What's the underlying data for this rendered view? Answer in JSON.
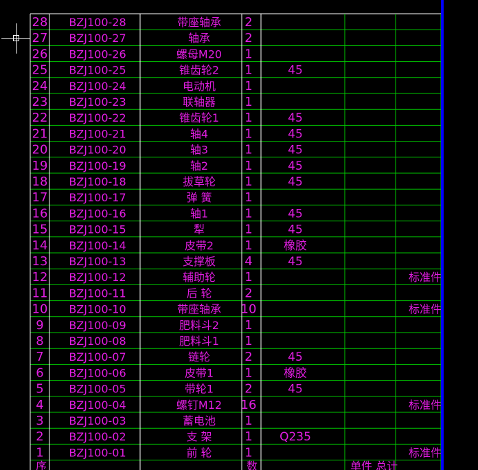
{
  "colors": {
    "background": "#000000",
    "text": "#e01ee0",
    "row_lines": "#00c800",
    "border_lines": "#ffffff",
    "right_rail": "#0000ff"
  },
  "header_bottom": {
    "seq_label": "序",
    "qty_label": "数",
    "tail_label": "单件 总计"
  },
  "rows": [
    {
      "no": "28",
      "code": "BZJ100-28",
      "name": "带座轴承",
      "qty": "2",
      "material": "",
      "remark": ""
    },
    {
      "no": "27",
      "code": "BZJ100-27",
      "name": "轴承",
      "qty": "2",
      "material": "",
      "remark": ""
    },
    {
      "no": "26",
      "code": "BZJ100-26",
      "name": "螺母M20",
      "qty": "1",
      "material": "",
      "remark": ""
    },
    {
      "no": "25",
      "code": "BZJ100-25",
      "name": "锥齿轮2",
      "qty": "1",
      "material": "45",
      "remark": ""
    },
    {
      "no": "24",
      "code": "BZJ100-24",
      "name": "电动机",
      "qty": "1",
      "material": "",
      "remark": ""
    },
    {
      "no": "23",
      "code": "BZJ100-23",
      "name": "联轴器",
      "qty": "1",
      "material": "",
      "remark": ""
    },
    {
      "no": "22",
      "code": "BZJ100-22",
      "name": "锥齿轮1",
      "qty": "1",
      "material": "45",
      "remark": ""
    },
    {
      "no": "21",
      "code": "BZJ100-21",
      "name": "轴4",
      "qty": "1",
      "material": "45",
      "remark": ""
    },
    {
      "no": "20",
      "code": "BZJ100-20",
      "name": "轴3",
      "qty": "1",
      "material": "45",
      "remark": ""
    },
    {
      "no": "19",
      "code": "BZJ100-19",
      "name": "轴2",
      "qty": "1",
      "material": "45",
      "remark": ""
    },
    {
      "no": "18",
      "code": "BZJ100-18",
      "name": "拔草轮",
      "qty": "1",
      "material": "45",
      "remark": ""
    },
    {
      "no": "17",
      "code": "BZJ100-17",
      "name": "弹 簧",
      "qty": "1",
      "material": "",
      "remark": ""
    },
    {
      "no": "16",
      "code": "BZJ100-16",
      "name": "轴1",
      "qty": "1",
      "material": "45",
      "remark": ""
    },
    {
      "no": "15",
      "code": "BZJ100-15",
      "name": "犁",
      "qty": "1",
      "material": "45",
      "remark": ""
    },
    {
      "no": "14",
      "code": "BZJ100-14",
      "name": "皮带2",
      "qty": "1",
      "material": "橡胶",
      "remark": ""
    },
    {
      "no": "13",
      "code": "BZJ100-13",
      "name": "支撑板",
      "qty": "4",
      "material": "45",
      "remark": ""
    },
    {
      "no": "12",
      "code": "BZJ100-12",
      "name": "辅助轮",
      "qty": "1",
      "material": "",
      "remark": "标准件"
    },
    {
      "no": "11",
      "code": "BZJ100-11",
      "name": "后 轮",
      "qty": "2",
      "material": "",
      "remark": ""
    },
    {
      "no": "10",
      "code": "BZJ100-10",
      "name": "带座轴承",
      "qty": "10",
      "material": "",
      "remark": "标准件"
    },
    {
      "no": "9",
      "code": "BZJ100-09",
      "name": "肥料斗2",
      "qty": "1",
      "material": "",
      "remark": ""
    },
    {
      "no": "8",
      "code": "BZJ100-08",
      "name": "肥料斗1",
      "qty": "1",
      "material": "",
      "remark": ""
    },
    {
      "no": "7",
      "code": "BZJ100-07",
      "name": "链轮",
      "qty": "2",
      "material": "45",
      "remark": ""
    },
    {
      "no": "6",
      "code": "BZJ100-06",
      "name": "皮带1",
      "qty": "1",
      "material": "橡胶",
      "remark": ""
    },
    {
      "no": "5",
      "code": "BZJ100-05",
      "name": "带轮1",
      "qty": "2",
      "material": "45",
      "remark": ""
    },
    {
      "no": "4",
      "code": "BZJ100-04",
      "name": "螺钉M12",
      "qty": "16",
      "material": "",
      "remark": "标准件"
    },
    {
      "no": "3",
      "code": "BZJ100-03",
      "name": "蓄电池",
      "qty": "1",
      "material": "",
      "remark": ""
    },
    {
      "no": "2",
      "code": "BZJ100-02",
      "name": "支 架",
      "qty": "1",
      "material": "Q235",
      "remark": ""
    },
    {
      "no": "1",
      "code": "BZJ100-01",
      "name": "前 轮",
      "qty": "1",
      "material": "",
      "remark": "标准件"
    }
  ]
}
